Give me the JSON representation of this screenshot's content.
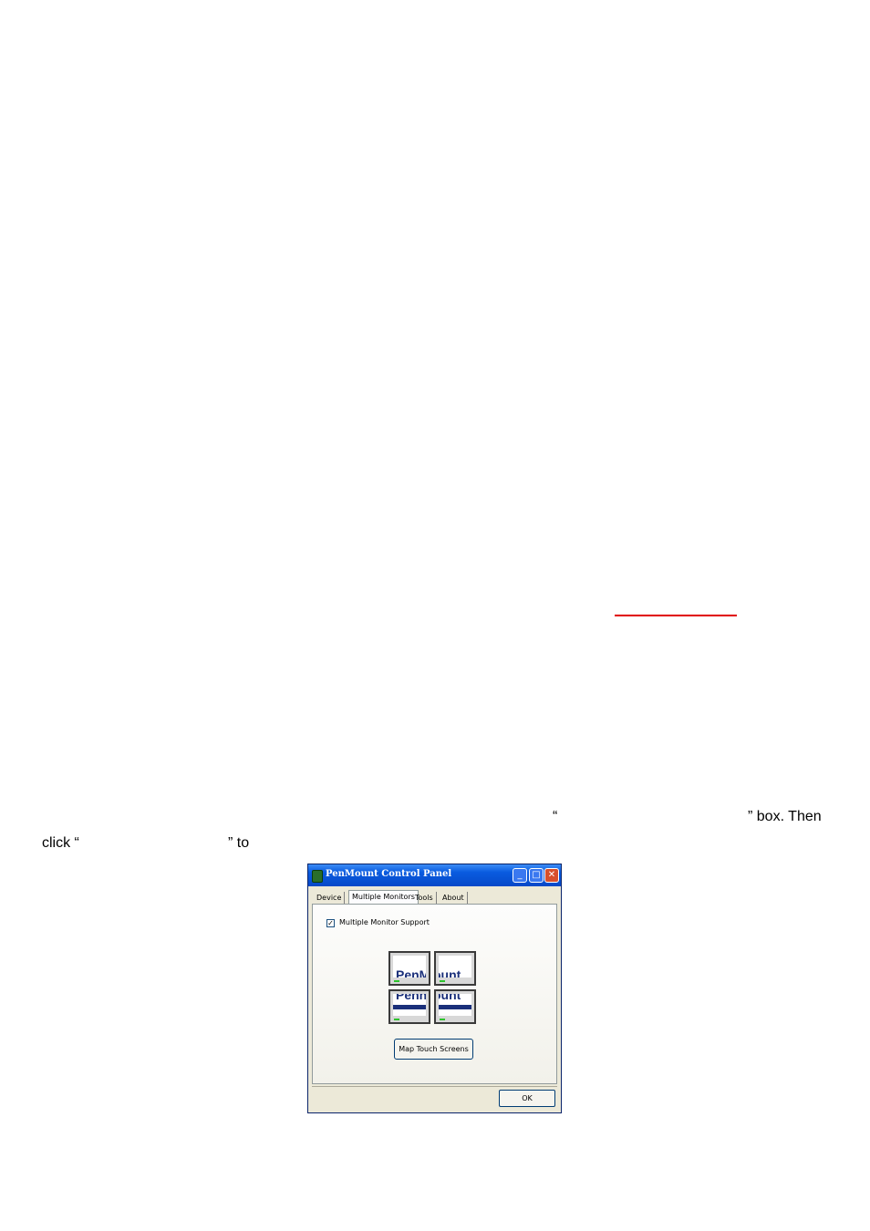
{
  "document": {
    "line1": {
      "open_quote": "“",
      "tail": "” box. Then"
    },
    "line2": {
      "text": "click “",
      "tail": "” to"
    },
    "accent_color": "#e00000"
  },
  "dialog": {
    "title": "PenMount Control Panel",
    "title_buttons": {
      "minimize": "_",
      "maximize": "□",
      "close": "✕"
    },
    "tabs": [
      "Device",
      "Multiple Monitors",
      "Tools",
      "About"
    ],
    "active_tab": "Multiple Monitors",
    "checkbox": {
      "label": "Multiple Monitor Support",
      "checked": true,
      "mark": "✓"
    },
    "monitor_logo": {
      "top_left": "PenM",
      "top_right": "ount",
      "bottom_left": "Penn",
      "bottom_right": "ount"
    },
    "map_button_label": "Map Touch Screens",
    "ok_label": "OK",
    "colors": {
      "titlebar": "#0a5ce0",
      "face": "#ece9d8",
      "logo": "#1a2f7a"
    }
  }
}
